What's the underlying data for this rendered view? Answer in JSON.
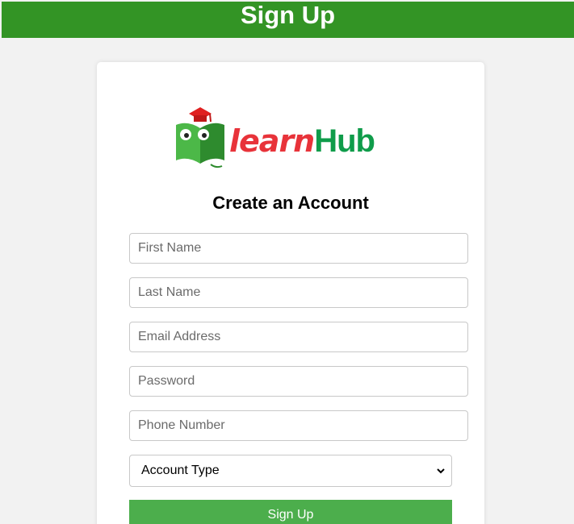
{
  "header": {
    "title": "Sign Up"
  },
  "logo": {
    "text_part1": "learn",
    "text_part2": "Hub",
    "icon": "book-graduation-cap-icon",
    "colors": {
      "learn": "#e8333a",
      "hub": "#0f9c4a",
      "cap": "#e02020",
      "book": "#4cb848"
    }
  },
  "form": {
    "heading": "Create an Account",
    "fields": {
      "first_name": {
        "placeholder": "First Name"
      },
      "last_name": {
        "placeholder": "Last Name"
      },
      "email": {
        "placeholder": "Email Address"
      },
      "password": {
        "placeholder": "Password"
      },
      "phone": {
        "placeholder": "Phone Number"
      }
    },
    "account_type": {
      "selected": "Account Type"
    },
    "submit_label": "Sign Up"
  },
  "colors": {
    "header_bg": "#339425",
    "button_bg": "#4cae4c",
    "page_bg": "#f2f2f2"
  }
}
